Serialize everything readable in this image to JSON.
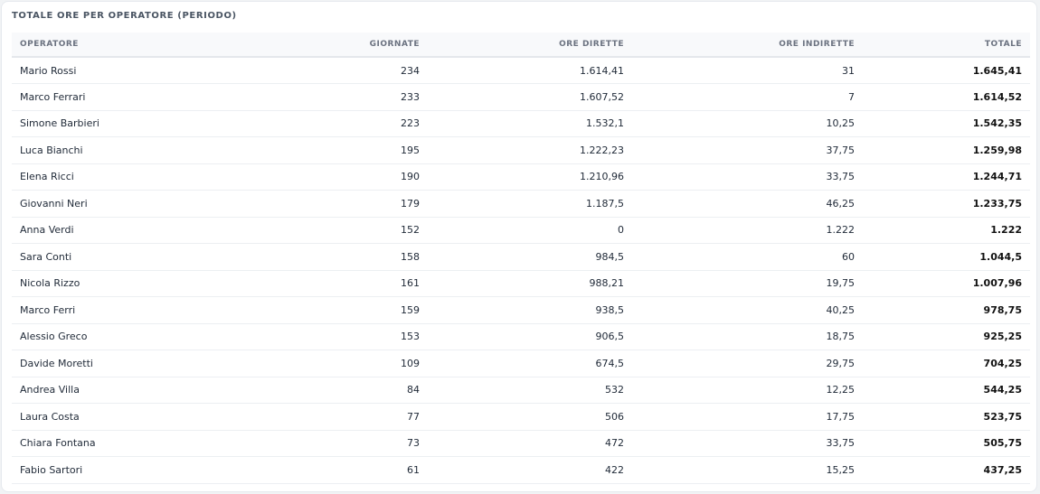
{
  "panel": {
    "title": "TOTALE ORE PER OPERATORE (PERIODO)"
  },
  "table": {
    "headers": [
      "OPERATORE",
      "GIORNATE",
      "ORE DIRETTE",
      "ORE INDIRETTE",
      "TOTALE"
    ],
    "rows": [
      [
        "Mario Rossi",
        "234",
        "1.614,41",
        "31",
        "1.645,41"
      ],
      [
        "Marco Ferrari",
        "233",
        "1.607,52",
        "7",
        "1.614,52"
      ],
      [
        "Simone Barbieri",
        "223",
        "1.532,1",
        "10,25",
        "1.542,35"
      ],
      [
        "Luca Bianchi",
        "195",
        "1.222,23",
        "37,75",
        "1.259,98"
      ],
      [
        "Elena Ricci",
        "190",
        "1.210,96",
        "33,75",
        "1.244,71"
      ],
      [
        "Giovanni Neri",
        "179",
        "1.187,5",
        "46,25",
        "1.233,75"
      ],
      [
        "Anna Verdi",
        "152",
        "0",
        "1.222",
        "1.222"
      ],
      [
        "Sara Conti",
        "158",
        "984,5",
        "60",
        "1.044,5"
      ],
      [
        "Nicola Rizzo",
        "161",
        "988,21",
        "19,75",
        "1.007,96"
      ],
      [
        "Marco Ferri",
        "159",
        "938,5",
        "40,25",
        "978,75"
      ],
      [
        "Alessio Greco",
        "153",
        "906,5",
        "18,75",
        "925,25"
      ],
      [
        "Davide Moretti",
        "109",
        "674,5",
        "29,75",
        "704,25"
      ],
      [
        "Andrea Villa",
        "84",
        "532",
        "12,25",
        "544,25"
      ],
      [
        "Laura Costa",
        "77",
        "506",
        "17,75",
        "523,75"
      ],
      [
        "Chiara Fontana",
        "73",
        "472",
        "33,75",
        "505,75"
      ],
      [
        "Fabio Sartori",
        "61",
        "422",
        "15,25",
        "437,25"
      ]
    ]
  }
}
